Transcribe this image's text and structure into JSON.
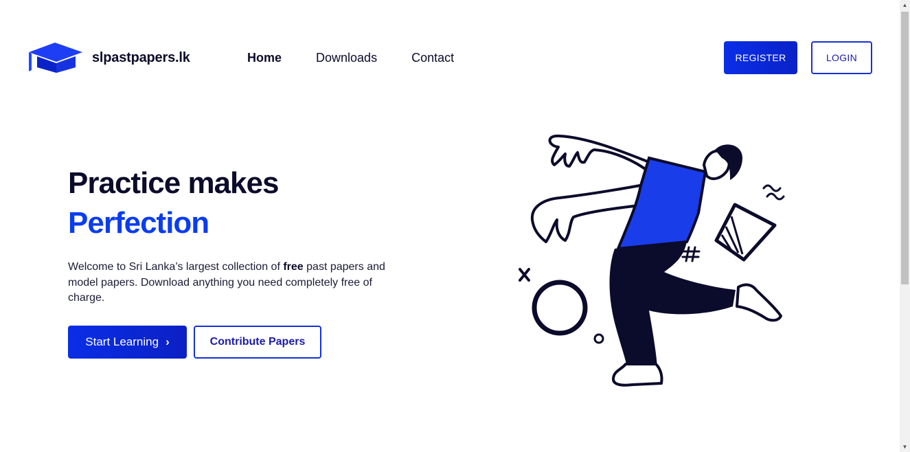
{
  "brand": {
    "name": "slpastpapers.lk",
    "logo_icon": "graduation-cap-icon"
  },
  "nav": {
    "items": [
      {
        "label": "Home",
        "active": true
      },
      {
        "label": "Downloads",
        "active": false
      },
      {
        "label": "Contact",
        "active": false
      }
    ]
  },
  "auth": {
    "register_label": "REGISTER",
    "login_label": "LOGIN"
  },
  "hero": {
    "title_line1": "Practice makes",
    "title_line2": "Perfection",
    "text_before": "Welcome to Sri Lanka’s largest collection of ",
    "text_bold": "free",
    "text_after": " past papers and model papers. Download anything you need completely free of charge.",
    "primary_button": "Start Learning",
    "primary_button_icon": "chevron-right-icon",
    "secondary_button": "Contribute Papers"
  },
  "colors": {
    "accent": "#0a3cf0",
    "dark": "#0b0b2b",
    "button_blue": "#0a2ee6"
  }
}
